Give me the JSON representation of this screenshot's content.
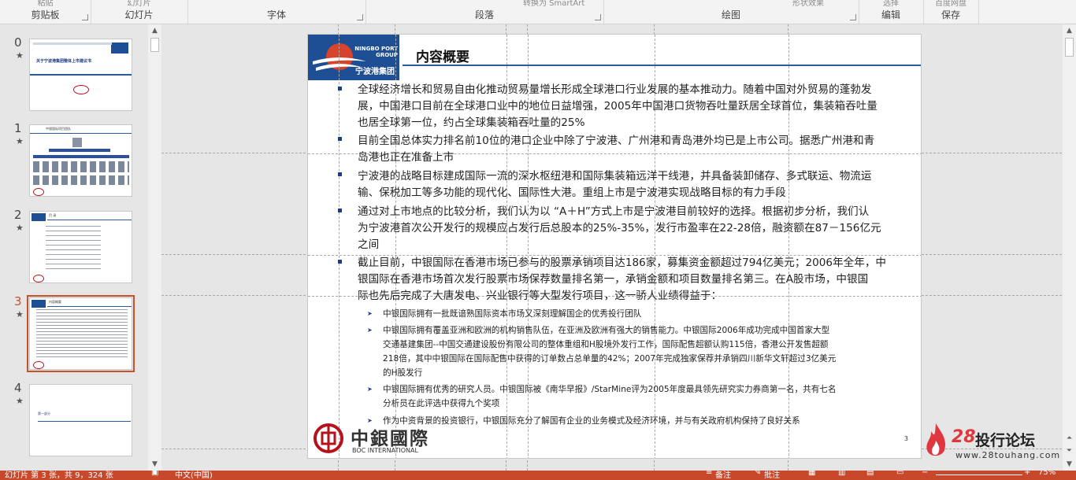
{
  "ribbon": {
    "groups": [
      {
        "top": "粘贴",
        "label": "剪贴板"
      },
      {
        "top": "幻灯片",
        "label": "幻灯片"
      },
      {
        "top": "",
        "label": "字体"
      },
      {
        "top": "转换为 SmartArt",
        "label": "段落"
      },
      {
        "top": "形状效果",
        "label": "绘图"
      },
      {
        "top": "选择",
        "label": "编辑"
      },
      {
        "top": "百度网盘",
        "label": "保存"
      }
    ]
  },
  "thumbnails": [
    {
      "num": "0",
      "star": "★",
      "title": "关于宁波港集团整体上市建议书",
      "selected": false
    },
    {
      "num": "1",
      "star": "★",
      "title": "中银国际项目团队",
      "selected": false
    },
    {
      "num": "2",
      "star": "★",
      "title": "目 录",
      "selected": false
    },
    {
      "num": "3",
      "star": "★",
      "title": "内容概要",
      "selected": true
    },
    {
      "num": "4",
      "star": "★",
      "title": "第一部分",
      "selected": false
    }
  ],
  "slide": {
    "logo_en": "NINGBO PORT GROUP",
    "logo_cn": "宁波港集团",
    "title": "内容概要",
    "bullets": [
      [
        "全球经济增长和贸易自由化推动贸易量增长形成全球港口行业发展的基本推动力。随着中国对外贸易的蓬勃发",
        "展，中国港口目前在全球港口业中的地位日益增强，2005年中国港口货物吞吐量跃居全球首位，集装箱吞吐量",
        "也居全球第一位，约占全球集装箱吞吐量的25%"
      ],
      [
        "目前全国总体实力排名前10位的港口企业中除了宁波港、广州港和青岛港外均已是上市公司。据悉广州港和青",
        "岛港也正在准备上市"
      ],
      [
        "宁波港的战略目标建成国际一流的深水枢纽港和国际集装箱远洋干线港，并具备装卸储存、多式联运、物流运",
        "输、保税加工等多功能的现代化、国际性大港。重组上市是宁波港实现战略目标的有力手段"
      ],
      [
        "通过对上市地点的比较分析，我们认为以 “A＋H”方式上市是宁波港目前较好的选择。根据初步分析，我们认",
        "为宁波港首次公开发行的规模应占发行后总股本的25%-35%，发行市盈率在22-28倍，融资额在87－156亿元",
        "之间"
      ],
      [
        "截止目前，中银国际在香港市场已参与的股票承销项目达186家，募集资金额超过794亿美元；2006年全年，中",
        "银国际在香港市场首次发行股票市场保荐数量排名第一，承销金额和项目数量排名第三。在A股市场，中银国",
        "际也先后完成了大唐发电、兴业银行等大型发行项目，这一骄人业绩得益于："
      ]
    ],
    "subbullets": [
      [
        "中银国际拥有一批既谙熟国际资本市场又深刻理解国企的优秀投行团队"
      ],
      [
        "中银国际拥有覆盖亚洲和欧洲的机构销售队伍，在亚洲及欧洲有强大的销售能力。中银国际2006年成功完成中国首家大型",
        "交通基建集团--中国交通建设股份有限公司的整体重组和H股境外发行工作，国际配售超额认购115倍，香港公开发售超额",
        "218倍，其中中银国际在国际配售中获得的订单数占总单量的42%；2007年完成独家保荐并承销四川新华文轩超过3亿美元",
        "的H股发行"
      ],
      [
        "中银国际拥有优秀的研究人员。中银国际被《南华早报》/StarMine评为2005年度最具领先研究实力券商第一名，共有七名",
        "分析员在此评选中获得九个奖项"
      ],
      [
        "作为中资背景的投资银行，中银国际充分了解国有企业的业务模式及经济环境，并与有关政府机构保持了良好关系"
      ]
    ],
    "boc_cn": "中銀國際",
    "boc_en": "BOC INTERNATIONAL",
    "page_number": "3"
  },
  "watermark": {
    "num": "28",
    "text": "投行论坛",
    "url": "www.28touhang.com"
  },
  "status": {
    "slide_info": "幻灯片 第 3 张，共 9，324 张",
    "language": "中文(中国)",
    "notes": "备注",
    "comments": "批注",
    "zoom": "75%"
  },
  "colors": {
    "accent": "#c7482a",
    "brand_blue": "#1e4f95",
    "boc_red": "#b5121b"
  }
}
